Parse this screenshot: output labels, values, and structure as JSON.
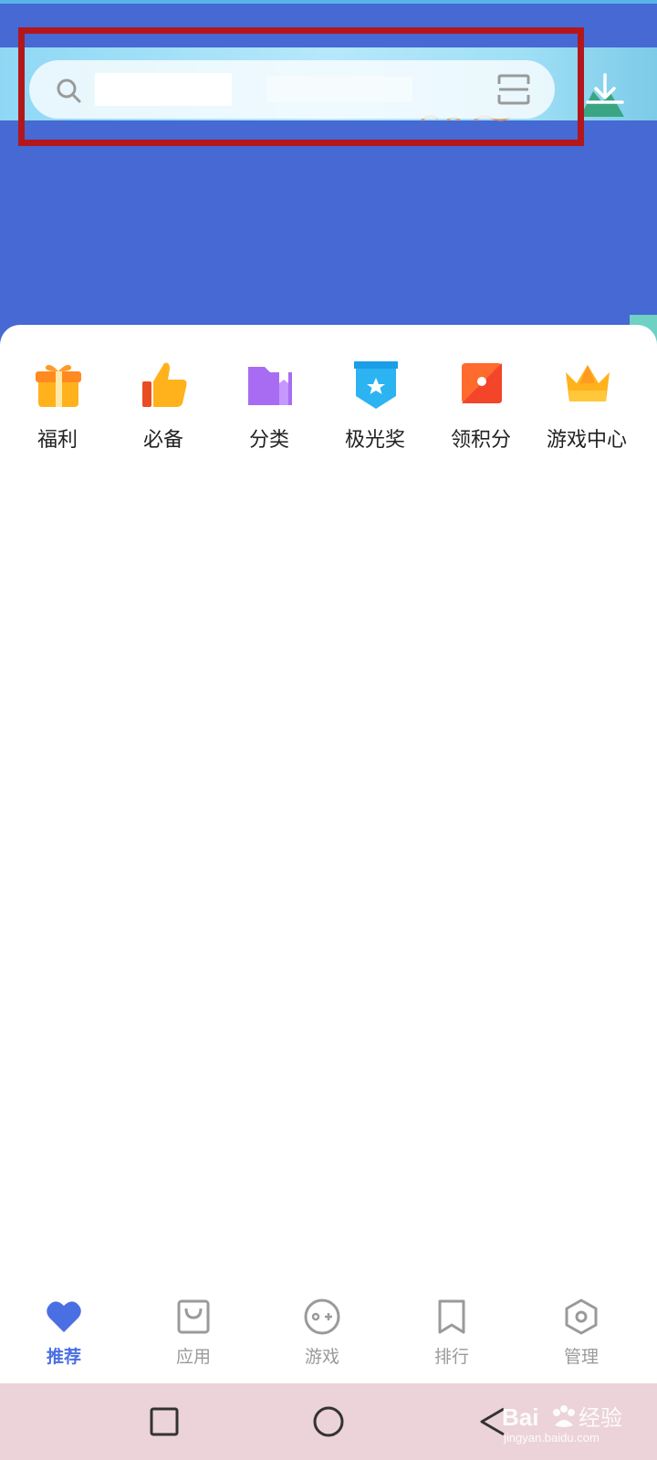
{
  "search": {
    "placeholder": "",
    "value": ""
  },
  "quick_menu": [
    {
      "label": "福利",
      "icon": "gift-icon"
    },
    {
      "label": "必备",
      "icon": "thumbs-up-icon"
    },
    {
      "label": "分类",
      "icon": "folder-icon"
    },
    {
      "label": "极光奖",
      "icon": "award-badge-icon"
    },
    {
      "label": "领积分",
      "icon": "points-icon"
    },
    {
      "label": "游戏中心",
      "icon": "crown-icon"
    }
  ],
  "bottom_nav": [
    {
      "label": "推荐",
      "icon": "heart-icon",
      "active": true
    },
    {
      "label": "应用",
      "icon": "shopping-bag-icon",
      "active": false
    },
    {
      "label": "游戏",
      "icon": "gamepad-icon",
      "active": false
    },
    {
      "label": "排行",
      "icon": "bookmark-icon",
      "active": false
    },
    {
      "label": "管理",
      "icon": "hexagon-settings-icon",
      "active": false
    }
  ],
  "watermark": {
    "brand": "Bai",
    "text": "经验",
    "url": "jingyan.baidu.com"
  },
  "colors": {
    "header_bg": "#4669d3",
    "accent": "#4a6fe3",
    "highlight_border": "#b3171c",
    "system_nav_bg": "#ebd3d9"
  }
}
